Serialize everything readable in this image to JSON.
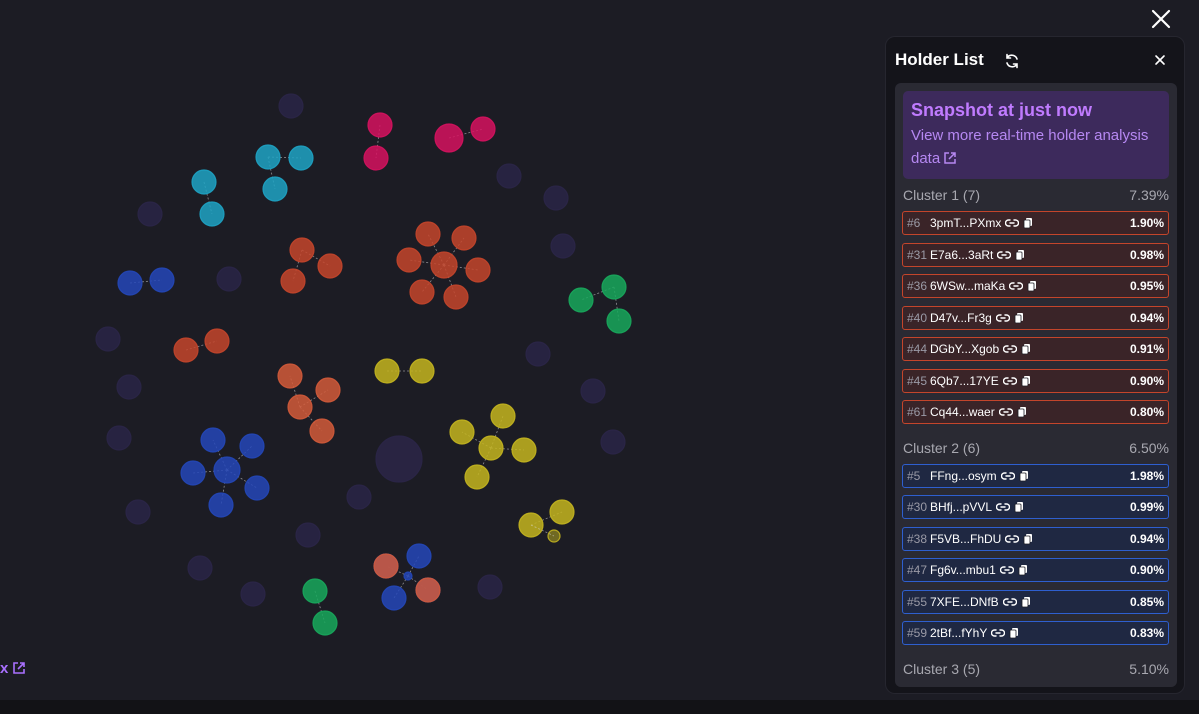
{
  "overlay": {
    "close_icon": "close-icon"
  },
  "external_link": {
    "text": "x",
    "icon": "external-link-icon"
  },
  "panel": {
    "title": "Holder List",
    "refresh_icon": "refresh-icon",
    "close_icon": "close-icon",
    "snapshot": {
      "title": "Snapshot at just now",
      "link_text": "View more real-time holder analysis data"
    },
    "clusters": [
      {
        "name": "Cluster 1 (7)",
        "percent": "7.39%",
        "color": "#c4452b",
        "holders": [
          {
            "rank": "#6",
            "address": "3pmT...PXmx",
            "percent": "1.90%"
          },
          {
            "rank": "#31",
            "address": "E7a6...3aRt",
            "percent": "0.98%"
          },
          {
            "rank": "#36",
            "address": "6WSw...maKa",
            "percent": "0.95%"
          },
          {
            "rank": "#40",
            "address": "D47v...Fr3g",
            "percent": "0.94%"
          },
          {
            "rank": "#44",
            "address": "DGbY...Xgob",
            "percent": "0.91%"
          },
          {
            "rank": "#45",
            "address": "6Qb7...17YE",
            "percent": "0.90%"
          },
          {
            "rank": "#61",
            "address": "Cq44...waer",
            "percent": "0.80%"
          }
        ]
      },
      {
        "name": "Cluster 2 (6)",
        "percent": "6.50%",
        "color": "#2e5fcf",
        "holders": [
          {
            "rank": "#5",
            "address": "FFng...osym",
            "percent": "1.98%"
          },
          {
            "rank": "#30",
            "address": "BHfj...pVVL",
            "percent": "0.99%"
          },
          {
            "rank": "#38",
            "address": "F5VB...FhDU",
            "percent": "0.94%"
          },
          {
            "rank": "#47",
            "address": "Fg6v...mbu1",
            "percent": "0.90%"
          },
          {
            "rank": "#55",
            "address": "7XFE...DNfB",
            "percent": "0.85%"
          },
          {
            "rank": "#59",
            "address": "2tBf...fYhY",
            "percent": "0.83%"
          }
        ]
      },
      {
        "name": "Cluster 3 (5)",
        "percent": "5.10%",
        "holders": []
      }
    ]
  },
  "graph": {
    "colors": {
      "lone": "#2b2648",
      "red": "#c4452b",
      "blue": "#2447b8",
      "cyan": "#1ea3c4",
      "pink": "#d6125f",
      "yellow": "#c4b51f",
      "green": "#18a85c",
      "orange": "#d25a3a"
    }
  }
}
